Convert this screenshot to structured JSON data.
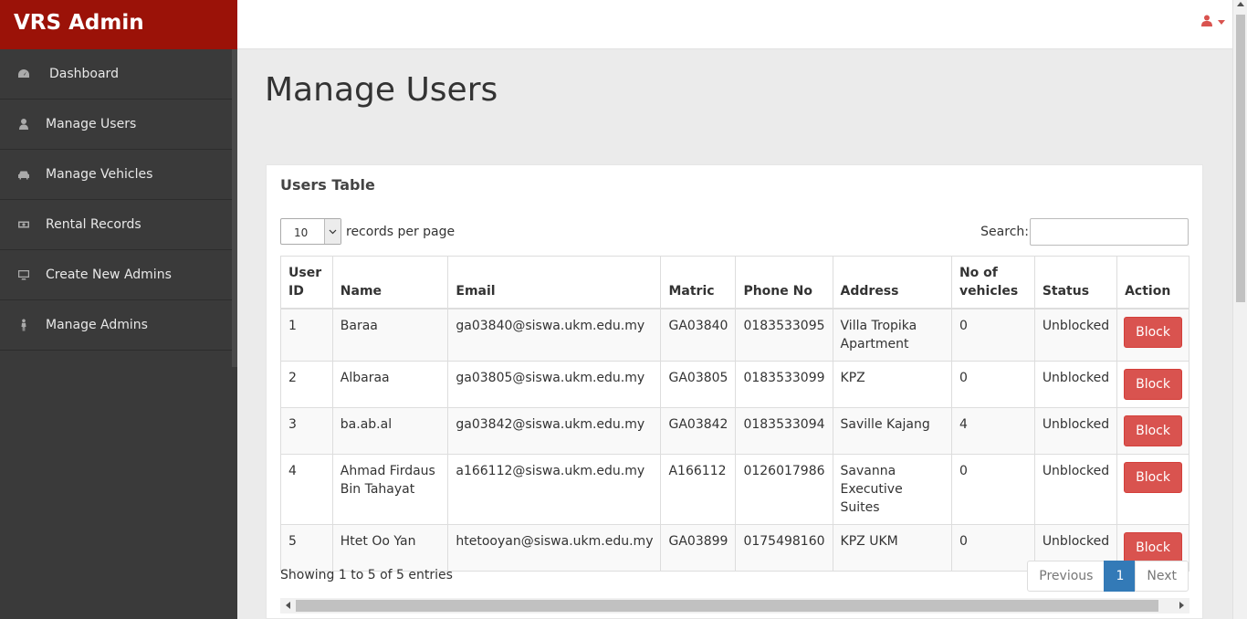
{
  "app": {
    "brand": "VRS Admin"
  },
  "sidebar": {
    "items": [
      {
        "label": "Dashboard",
        "icon": "dashboard-icon"
      },
      {
        "label": "Manage Users",
        "icon": "user-icon"
      },
      {
        "label": "Manage Vehicles",
        "icon": "car-icon"
      },
      {
        "label": "Rental Records",
        "icon": "money-icon"
      },
      {
        "label": "Create New Admins",
        "icon": "desktop-icon"
      },
      {
        "label": "Manage Admins",
        "icon": "male-icon"
      }
    ]
  },
  "header": {
    "user_icon": "user-icon",
    "accent": "#d9534f"
  },
  "main": {
    "page_title": "Manage Users",
    "panel_title": "Users Table",
    "length_value": "10",
    "length_label": "records per page",
    "search_label": "Search:",
    "search_value": "",
    "columns": [
      "User ID",
      "Name",
      "Email",
      "Matric",
      "Phone No",
      "Address",
      "No of vehicles",
      "Status",
      "Action"
    ],
    "rows": [
      {
        "id": "1",
        "name": "Baraa",
        "email": "ga03840@siswa.ukm.edu.my",
        "matric": "GA03840",
        "phone": "0183533095",
        "address": "Villa Tropika Apartment",
        "vehicles": "0",
        "status": "Unblocked",
        "action": "Block"
      },
      {
        "id": "2",
        "name": "Albaraa",
        "email": "ga03805@siswa.ukm.edu.my",
        "matric": "GA03805",
        "phone": "0183533099",
        "address": "KPZ",
        "vehicles": "0",
        "status": "Unblocked",
        "action": "Block"
      },
      {
        "id": "3",
        "name": "ba.ab.al",
        "email": "ga03842@siswa.ukm.edu.my",
        "matric": "GA03842",
        "phone": "0183533094",
        "address": "Saville Kajang",
        "vehicles": "4",
        "status": "Unblocked",
        "action": "Block"
      },
      {
        "id": "4",
        "name": "Ahmad Firdaus Bin Tahayat",
        "email": "a166112@siswa.ukm.edu.my",
        "matric": "A166112",
        "phone": "0126017986",
        "address": "Savanna Executive Suites",
        "vehicles": "0",
        "status": "Unblocked",
        "action": "Block"
      },
      {
        "id": "5",
        "name": "Htet Oo Yan",
        "email": "htetooyan@siswa.ukm.edu.my",
        "matric": "GA03899",
        "phone": "0175498160",
        "address": "KPZ UKM",
        "vehicles": "0",
        "status": "Unblocked",
        "action": "Block"
      }
    ],
    "info": "Showing 1 to 5 of 5 entries",
    "pagination": {
      "previous": "Previous",
      "current": "1",
      "next": "Next"
    }
  },
  "colors": {
    "brand_bg": "#9b1208",
    "sidebar_bg": "#3a3a3a",
    "danger": "#d9534f",
    "primary": "#337ab7"
  }
}
